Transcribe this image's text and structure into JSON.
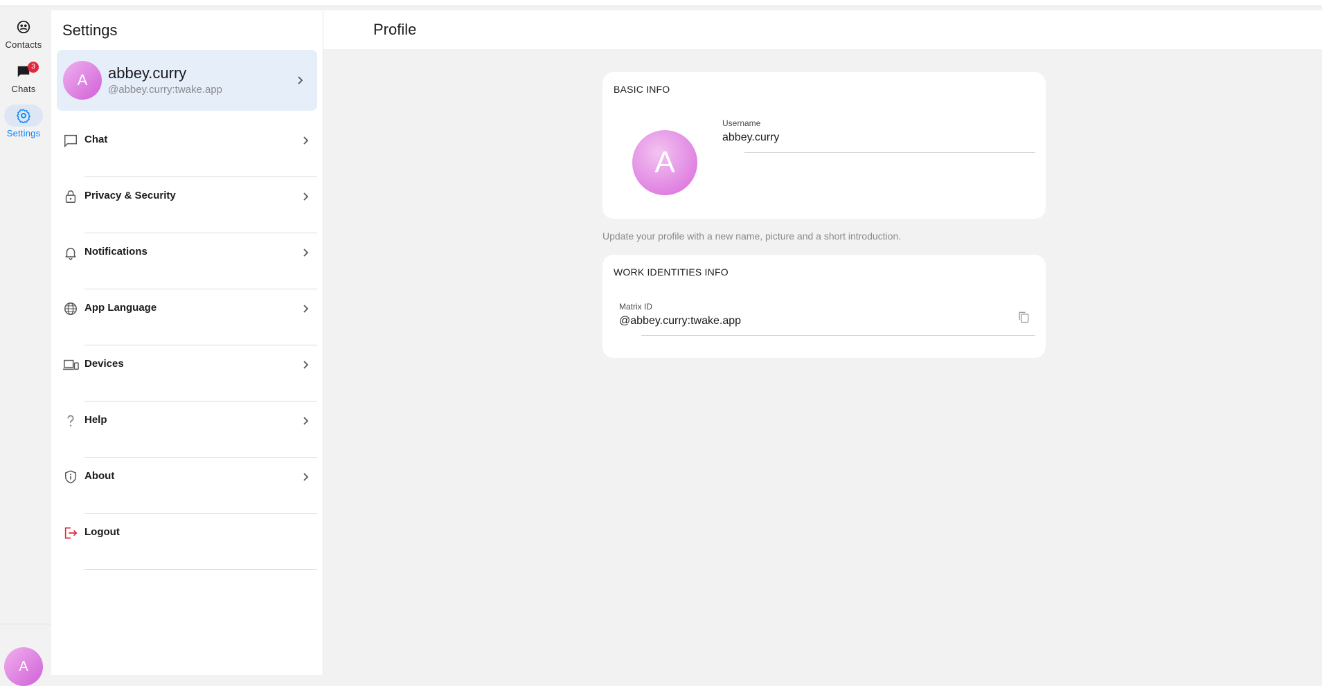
{
  "rail": {
    "contacts_label": "Contacts",
    "chats_label": "Chats",
    "chats_badge": "3",
    "settings_label": "Settings",
    "avatar_letter": "A"
  },
  "settings": {
    "title": "Settings",
    "profile": {
      "avatar_letter": "A",
      "name": "abbey.curry",
      "mxid": "@abbey.curry:twake.app"
    },
    "menu": [
      {
        "label": "Chat",
        "icon": "chat-bubble-icon"
      },
      {
        "label": "Privacy & Security",
        "icon": "lock-icon"
      },
      {
        "label": "Notifications",
        "icon": "bell-icon"
      },
      {
        "label": "App Language",
        "icon": "globe-icon"
      },
      {
        "label": "Devices",
        "icon": "devices-icon"
      },
      {
        "label": "Help",
        "icon": "help-icon"
      },
      {
        "label": "About",
        "icon": "shield-info-icon"
      },
      {
        "label": "Logout",
        "icon": "logout-icon"
      }
    ]
  },
  "header": {
    "title": "Profile"
  },
  "basic_info": {
    "title": "BASIC INFO",
    "avatar_letter": "A",
    "username_label": "Username",
    "username_value": "abbey.curry"
  },
  "hint": "Update your profile with a new name, picture and a short introduction.",
  "work_info": {
    "title": "WORK IDENTITIES INFO",
    "matrix_label": "Matrix ID",
    "matrix_value": "@abbey.curry:twake.app"
  },
  "colors": {
    "accent": "#0a84ff",
    "badge": "#e2283a",
    "logout": "#e2283a",
    "avatar": "#d867dc"
  }
}
